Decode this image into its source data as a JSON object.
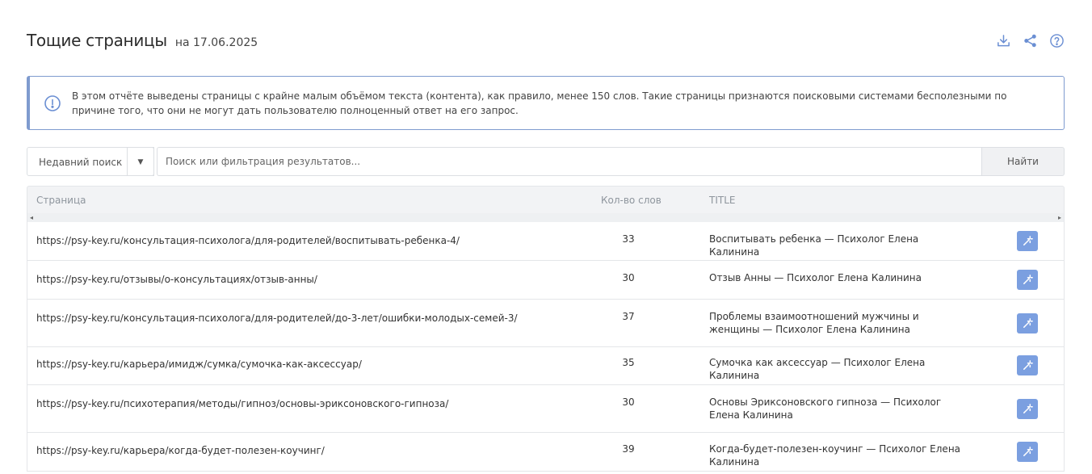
{
  "header": {
    "title": "Тощие страницы",
    "date": "на 17.06.2025"
  },
  "top_icons": [
    "download-icon",
    "share-icon",
    "help-icon"
  ],
  "info": {
    "text": "В этом отчёте выведены страницы с крайне малым объёмом текста (контента), как правило, менее 150 слов. Такие страницы признаются поисковыми системами бесполезными по причине того, что они не могут дать пользователю полноценный ответ на его запрос."
  },
  "filter": {
    "recent_label": "Недавний поиск",
    "recent_arrow": "▼",
    "search_placeholder": "Поиск или фильтрация результатов...",
    "find_label": "Найти"
  },
  "table": {
    "columns": {
      "page": "Страница",
      "words": "Кол-во слов",
      "title": "TITLE"
    },
    "rows": [
      {
        "url": "https://psy-key.ru/консультация-психолога/для-родителей/воспитывать-ребенка-4/",
        "words": "33",
        "title": "Воспитывать ребенка — Психолог Елена Калинина"
      },
      {
        "url": "https://psy-key.ru/отзывы/о-консультациях/отзыв-анны/",
        "words": "30",
        "title": "Отзыв Анны — Психолог Елена Калинина"
      },
      {
        "url": "https://psy-key.ru/консультация-психолога/для-родителей/до-3-лет/ошибки-молодых-семей-3/",
        "words": "37",
        "title": "Проблемы взаимоотношений мужчины и женщины — Психолог Елена Калинина"
      },
      {
        "url": "https://psy-key.ru/карьера/имидж/сумка/сумочка-как-аксессуар/",
        "words": "35",
        "title": "Сумочка как аксессуар — Психолог Елена Калинина"
      },
      {
        "url": "https://psy-key.ru/психотерапия/методы/гипноз/основы-эриксоновского-гипноза/",
        "words": "30",
        "title": "Основы Эриксоновского гипноза — Психолог Елена Калинина"
      },
      {
        "url": "https://psy-key.ru/карьера/когда-будет-полезен-коучинг/",
        "words": "39",
        "title": "Когда-будет-полезен-коучинг — Психолог Елена Калинина"
      }
    ]
  },
  "colors": {
    "accent": "#7b9fe0",
    "info_border": "#7f9bcf",
    "header_bg": "#f2f3f5"
  }
}
